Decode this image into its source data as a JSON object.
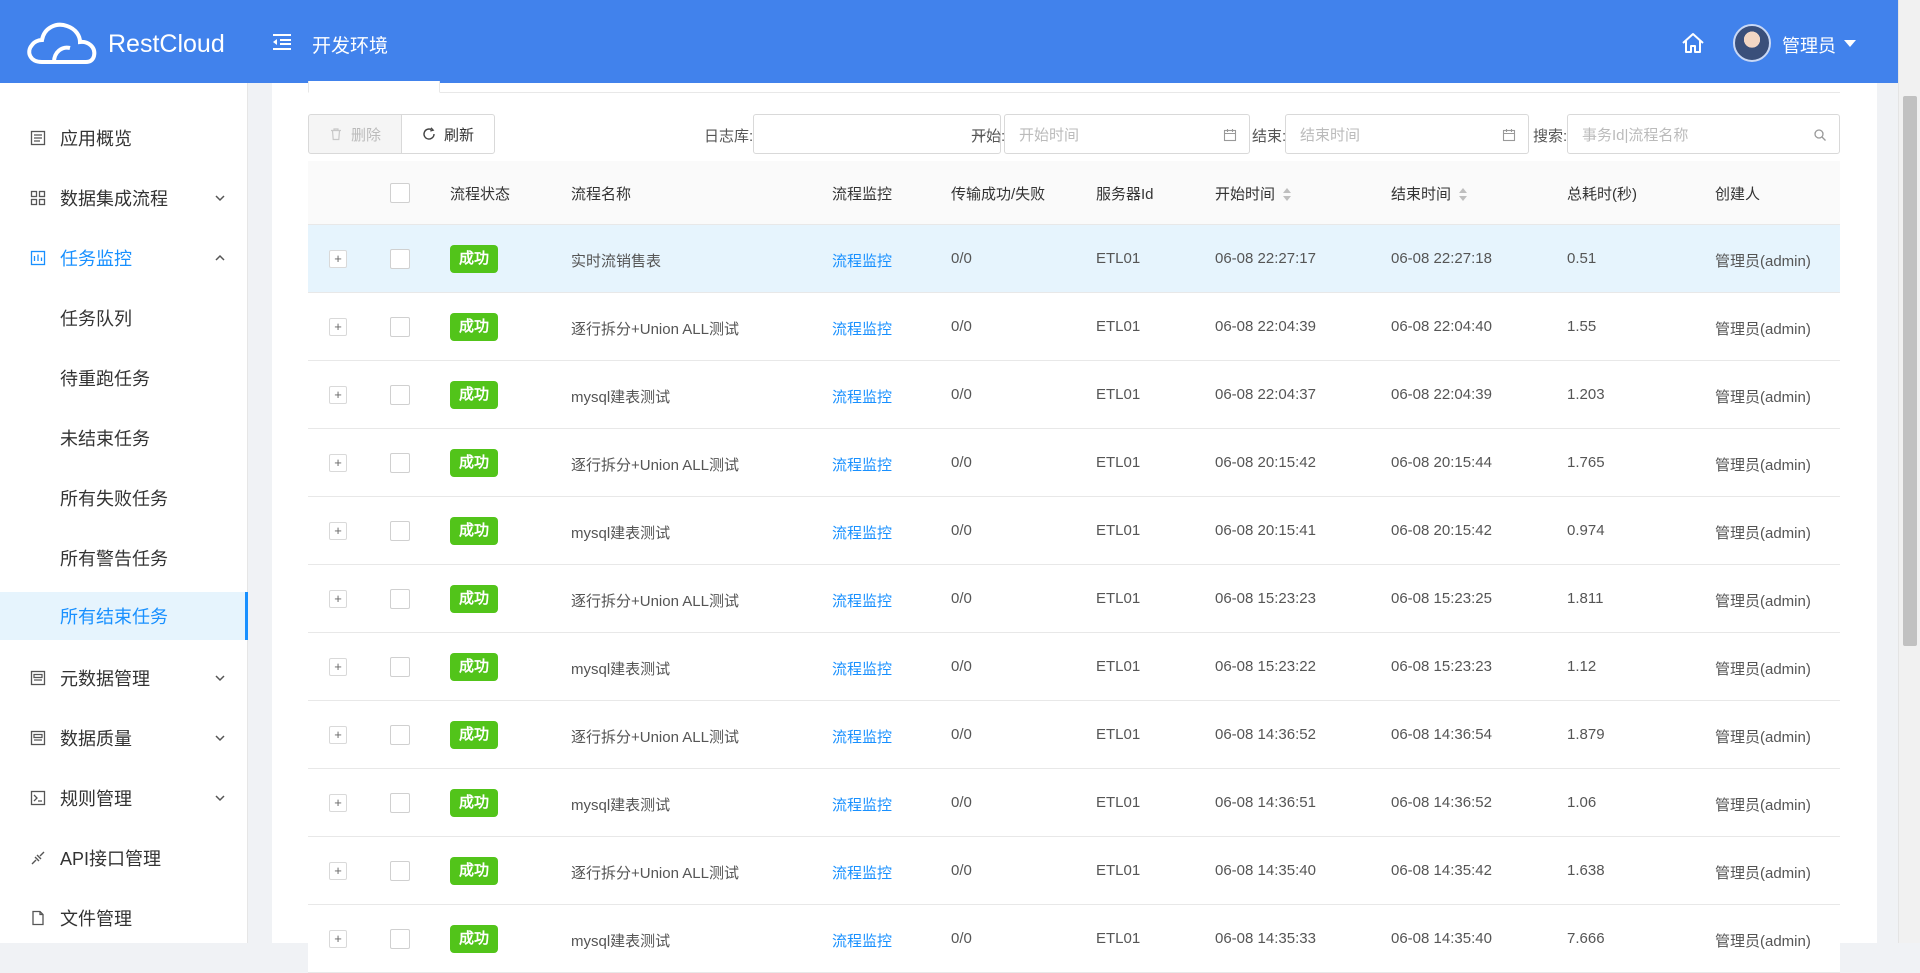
{
  "header": {
    "brand": "RestCloud",
    "env_title": "开发环境",
    "user_name": "管理员",
    "colors": {
      "bar": "#4182ec",
      "accent": "#1890ff",
      "success": "#52c41a"
    }
  },
  "sidebar": {
    "items": [
      {
        "label": "应用概览",
        "icon": "overview-icon",
        "has_caret": false
      },
      {
        "label": "数据集成流程",
        "icon": "grid-icon",
        "has_caret": true
      },
      {
        "label": "任务监控",
        "icon": "monitor-icon",
        "has_caret": true,
        "expanded": true
      },
      {
        "label": "任务队列"
      },
      {
        "label": "待重跑任务"
      },
      {
        "label": "未结束任务"
      },
      {
        "label": "所有失败任务"
      },
      {
        "label": "所有警告任务"
      },
      {
        "label": "所有结束任务",
        "active": true
      },
      {
        "label": "元数据管理",
        "icon": "metadata-icon",
        "has_caret": true
      },
      {
        "label": "数据质量",
        "icon": "quality-icon",
        "has_caret": true
      },
      {
        "label": "规则管理",
        "icon": "rule-icon",
        "has_caret": true
      },
      {
        "label": "API接口管理",
        "icon": "api-icon",
        "has_caret": false
      },
      {
        "label": "文件管理",
        "icon": "file-icon",
        "has_caret": false
      }
    ]
  },
  "toolbar": {
    "delete_label": "删除",
    "refresh_label": "刷新",
    "log_label": "日志库:",
    "log_value": "",
    "start_label": "开始:",
    "start_placeholder": "开始时间",
    "end_label": "结束:",
    "end_placeholder": "结束时间",
    "search_label": "搜索:",
    "search_placeholder": "事务Id|流程名称"
  },
  "table": {
    "columns": [
      "流程状态",
      "流程名称",
      "流程监控",
      "传输成功/失败",
      "服务器Id",
      "开始时间",
      "结束时间",
      "总耗时(秒)",
      "创建人"
    ],
    "rows": [
      {
        "status": "成功",
        "name": "实时流销售表",
        "monitor": "流程监控",
        "transfer": "0/0",
        "server": "ETL01",
        "start": "06-08 22:27:17",
        "end": "06-08 22:27:18",
        "duration": "0.51",
        "creator": "管理员(admin)"
      },
      {
        "status": "成功",
        "name": "逐行拆分+Union ALL测试",
        "monitor": "流程监控",
        "transfer": "0/0",
        "server": "ETL01",
        "start": "06-08 22:04:39",
        "end": "06-08 22:04:40",
        "duration": "1.55",
        "creator": "管理员(admin)"
      },
      {
        "status": "成功",
        "name": "mysql建表测试",
        "monitor": "流程监控",
        "transfer": "0/0",
        "server": "ETL01",
        "start": "06-08 22:04:37",
        "end": "06-08 22:04:39",
        "duration": "1.203",
        "creator": "管理员(admin)"
      },
      {
        "status": "成功",
        "name": "逐行拆分+Union ALL测试",
        "monitor": "流程监控",
        "transfer": "0/0",
        "server": "ETL01",
        "start": "06-08 20:15:42",
        "end": "06-08 20:15:44",
        "duration": "1.765",
        "creator": "管理员(admin)"
      },
      {
        "status": "成功",
        "name": "mysql建表测试",
        "monitor": "流程监控",
        "transfer": "0/0",
        "server": "ETL01",
        "start": "06-08 20:15:41",
        "end": "06-08 20:15:42",
        "duration": "0.974",
        "creator": "管理员(admin)"
      },
      {
        "status": "成功",
        "name": "逐行拆分+Union ALL测试",
        "monitor": "流程监控",
        "transfer": "0/0",
        "server": "ETL01",
        "start": "06-08 15:23:23",
        "end": "06-08 15:23:25",
        "duration": "1.811",
        "creator": "管理员(admin)"
      },
      {
        "status": "成功",
        "name": "mysql建表测试",
        "monitor": "流程监控",
        "transfer": "0/0",
        "server": "ETL01",
        "start": "06-08 15:23:22",
        "end": "06-08 15:23:23",
        "duration": "1.12",
        "creator": "管理员(admin)"
      },
      {
        "status": "成功",
        "name": "逐行拆分+Union ALL测试",
        "monitor": "流程监控",
        "transfer": "0/0",
        "server": "ETL01",
        "start": "06-08 14:36:52",
        "end": "06-08 14:36:54",
        "duration": "1.879",
        "creator": "管理员(admin)"
      },
      {
        "status": "成功",
        "name": "mysql建表测试",
        "monitor": "流程监控",
        "transfer": "0/0",
        "server": "ETL01",
        "start": "06-08 14:36:51",
        "end": "06-08 14:36:52",
        "duration": "1.06",
        "creator": "管理员(admin)"
      },
      {
        "status": "成功",
        "name": "逐行拆分+Union ALL测试",
        "monitor": "流程监控",
        "transfer": "0/0",
        "server": "ETL01",
        "start": "06-08 14:35:40",
        "end": "06-08 14:35:42",
        "duration": "1.638",
        "creator": "管理员(admin)"
      },
      {
        "status": "成功",
        "name": "mysql建表测试",
        "monitor": "流程监控",
        "transfer": "0/0",
        "server": "ETL01",
        "start": "06-08 14:35:33",
        "end": "06-08 14:35:40",
        "duration": "7.666",
        "creator": "管理员(admin)"
      }
    ]
  }
}
